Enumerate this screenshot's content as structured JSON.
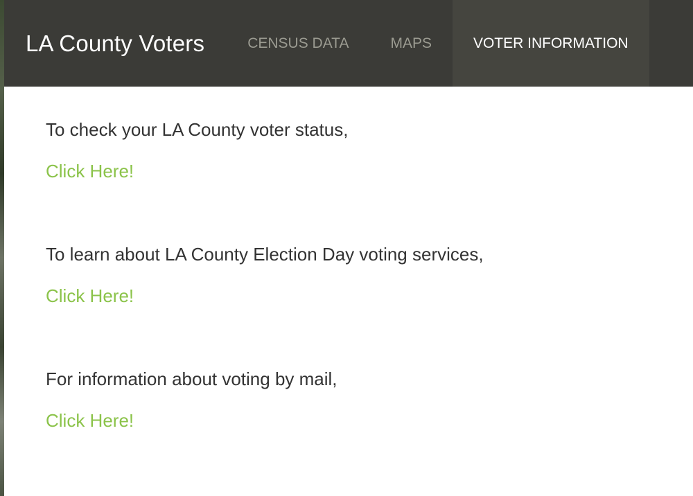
{
  "header": {
    "brand": "LA County Voters",
    "nav": [
      {
        "label": "CENSUS DATA",
        "active": false
      },
      {
        "label": "MAPS",
        "active": false
      },
      {
        "label": "VOTER INFORMATION",
        "active": true
      }
    ]
  },
  "main": {
    "sections": [
      {
        "prompt": "To check your LA County voter status,",
        "link": "Click Here!"
      },
      {
        "prompt": "To learn about LA County Election Day voting services,",
        "link": "Click Here!"
      },
      {
        "prompt": "For information about voting by mail,",
        "link": "Click Here!"
      }
    ]
  },
  "colors": {
    "navbar_bg": "#3b3b37",
    "active_tab_bg": "#45453f",
    "link": "#8bc34a",
    "text": "#333333"
  }
}
